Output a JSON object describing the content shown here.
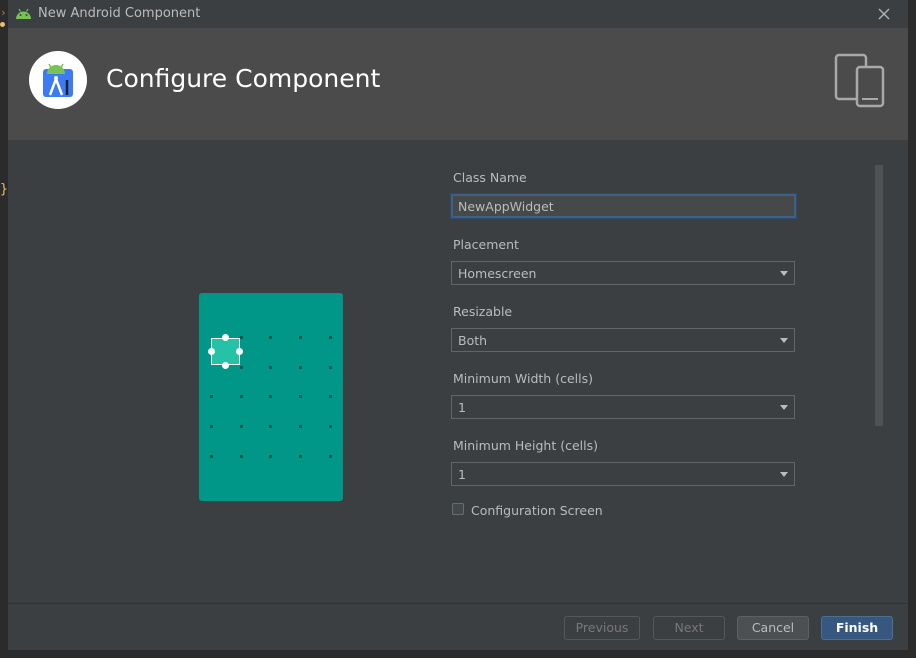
{
  "window": {
    "title": "New Android Component",
    "app_icon": "android-icon",
    "close_icon": "close-icon"
  },
  "header": {
    "heading": "Configure Component",
    "logo_icon": "android-studio-logo",
    "devices_icon": "tablet-phone-icon"
  },
  "preview": {
    "widget": {
      "columns": 1,
      "rows": 1
    }
  },
  "form": {
    "class_name": {
      "label": "Class Name",
      "value": "NewAppWidget"
    },
    "placement": {
      "label": "Placement",
      "value": "Homescreen"
    },
    "resizable": {
      "label": "Resizable",
      "value": "Both"
    },
    "min_width": {
      "label": "Minimum Width (cells)",
      "value": "1"
    },
    "min_height": {
      "label": "Minimum Height (cells)",
      "value": "1"
    },
    "config_screen": {
      "label": "Configuration Screen",
      "checked": false
    }
  },
  "footer": {
    "previous": "Previous",
    "next": "Next",
    "cancel": "Cancel",
    "finish": "Finish"
  },
  "colors": {
    "accent": "#365880",
    "preview_background": "#009688",
    "dialog_background": "#3c3f41"
  }
}
